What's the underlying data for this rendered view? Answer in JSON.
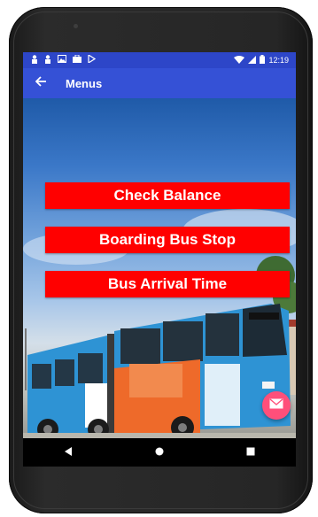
{
  "status_bar": {
    "left_icons": [
      "person-icon",
      "person-icon",
      "image-icon",
      "briefcase-icon",
      "play-icon"
    ],
    "right_icons": [
      "wifi-icon",
      "signal-icon",
      "battery-icon"
    ],
    "time": "12:19",
    "color": "#2d46c8"
  },
  "toolbar": {
    "title": "Menus",
    "back_icon": "arrow-back-icon",
    "color": "#3551d6"
  },
  "menu": {
    "buttons": [
      {
        "label": "Check Balance"
      },
      {
        "label": "Boarding Bus Stop"
      },
      {
        "label": "Bus Arrival Time"
      }
    ],
    "button_color": "#ff0000"
  },
  "fab": {
    "icon": "mail-icon",
    "color": "#ff4f7a"
  },
  "nav_bar": {
    "icons": [
      "back-triangle-icon",
      "home-circle-icon",
      "recents-square-icon"
    ]
  },
  "background_image": "articulated-bus-at-station"
}
